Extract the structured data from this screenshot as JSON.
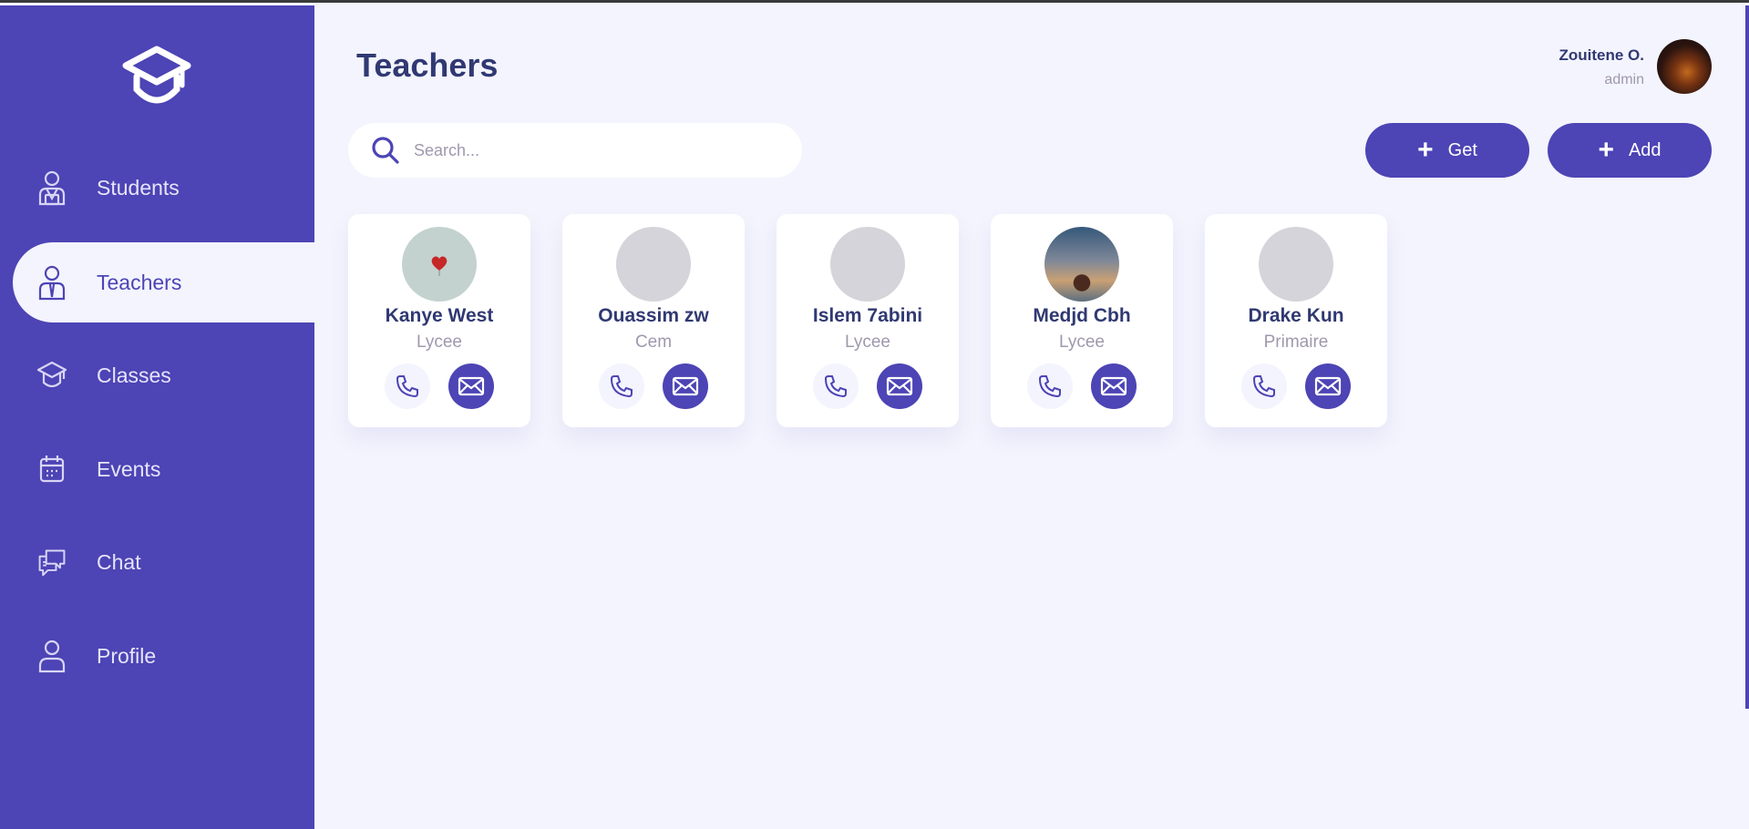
{
  "nav": {
    "items": [
      {
        "label": "Students",
        "icon": "student-icon"
      },
      {
        "label": "Teachers",
        "icon": "teacher-icon",
        "active": true
      },
      {
        "label": "Classes",
        "icon": "classes-icon"
      },
      {
        "label": "Events",
        "icon": "calendar-icon"
      },
      {
        "label": "Chat",
        "icon": "chat-icon"
      },
      {
        "label": "Profile",
        "icon": "profile-icon"
      }
    ]
  },
  "header": {
    "title": "Teachers",
    "user_name": "Zouitene O.",
    "user_role": "admin"
  },
  "search": {
    "placeholder": "Search..."
  },
  "toolbar": {
    "get_label": "Get",
    "add_label": "Add"
  },
  "teachers": [
    {
      "name": "Kanye West",
      "level": "Lycee"
    },
    {
      "name": "Ouassim zw",
      "level": "Cem"
    },
    {
      "name": "Islem 7abini",
      "level": "Lycee"
    },
    {
      "name": "Medjd Cbh",
      "level": "Lycee"
    },
    {
      "name": "Drake Kun",
      "level": "Primaire"
    }
  ],
  "colors": {
    "primary": "#4D44B5",
    "background": "#F3F4FD",
    "text_dark": "#303972",
    "text_muted": "#A098AE"
  }
}
